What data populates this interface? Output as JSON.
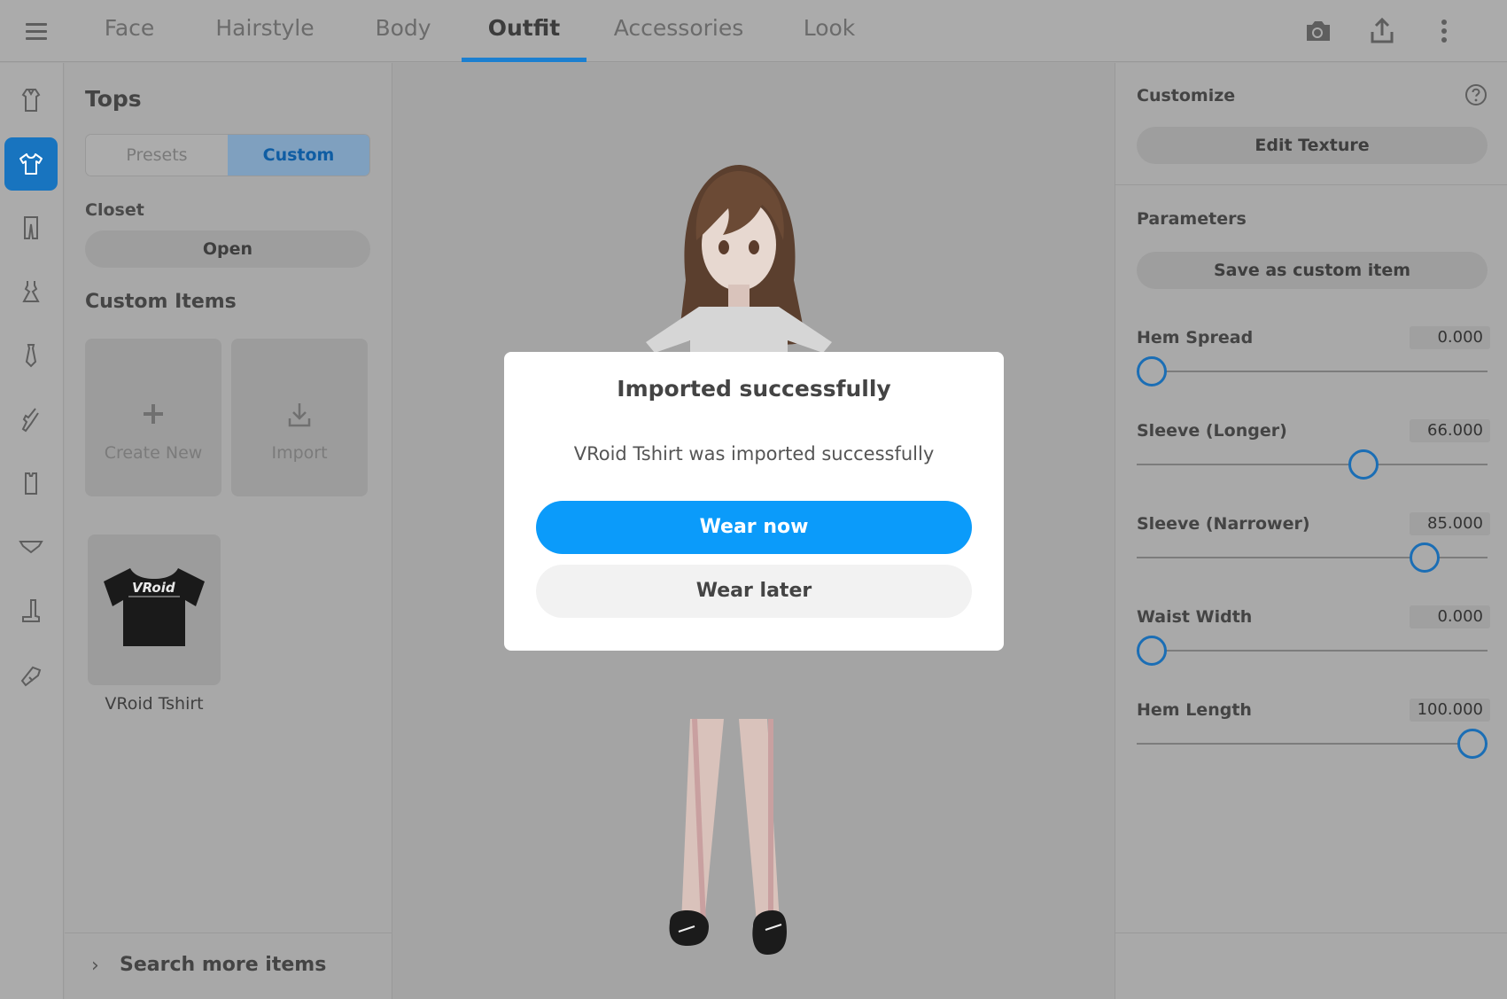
{
  "nav": {
    "menu_icon": "hamburger-menu-icon",
    "tabs": [
      {
        "label": "Face"
      },
      {
        "label": "Hairstyle"
      },
      {
        "label": "Body"
      },
      {
        "label": "Outfit",
        "active": true
      },
      {
        "label": "Accessories"
      },
      {
        "label": "Look"
      }
    ],
    "actions": [
      "camera-icon",
      "share-icon",
      "more-vertical-icon"
    ]
  },
  "rail": {
    "items": [
      "outfit-set-icon",
      "tops-icon",
      "bottoms-icon",
      "onepiece-icon",
      "neck-tie-icon",
      "gloves-icon",
      "socks-icon",
      "underwear-icon",
      "shoes-icon",
      "accessory-icon"
    ],
    "active_index": 1
  },
  "left_panel": {
    "title": "Tops",
    "segments": {
      "presets": "Presets",
      "custom": "Custom",
      "active": "custom"
    },
    "closet": {
      "label": "Closet",
      "button": "Open"
    },
    "custom_items_title": "Custom Items",
    "create_new": "Create New",
    "import": "Import",
    "items": [
      {
        "name": "VRoid Tshirt",
        "logo_text": "VRoid"
      }
    ],
    "footer": "Search more items"
  },
  "right_panel": {
    "customize_label": "Customize",
    "edit_texture": "Edit Texture",
    "parameters_label": "Parameters",
    "save_custom": "Save as custom item",
    "params": [
      {
        "name": "Hem Spread",
        "value": "0.000",
        "level": 0
      },
      {
        "name": "Sleeve (Longer)",
        "value": "66.000",
        "level": 0.66
      },
      {
        "name": "Sleeve (Narrower)",
        "value": "85.000",
        "level": 0.85
      },
      {
        "name": "Waist Width",
        "value": "0.000",
        "level": 0
      },
      {
        "name": "Hem Length",
        "value": "100.000",
        "level": 1.0
      }
    ]
  },
  "modal": {
    "title": "Imported successfully",
    "message": "VRoid Tshirt was imported successfully",
    "primary": "Wear now",
    "secondary": "Wear later"
  },
  "colors": {
    "accent": "#1b7fd0",
    "primary_button": "#0b9bfa",
    "slider_thumb": "#1b6eb5"
  }
}
